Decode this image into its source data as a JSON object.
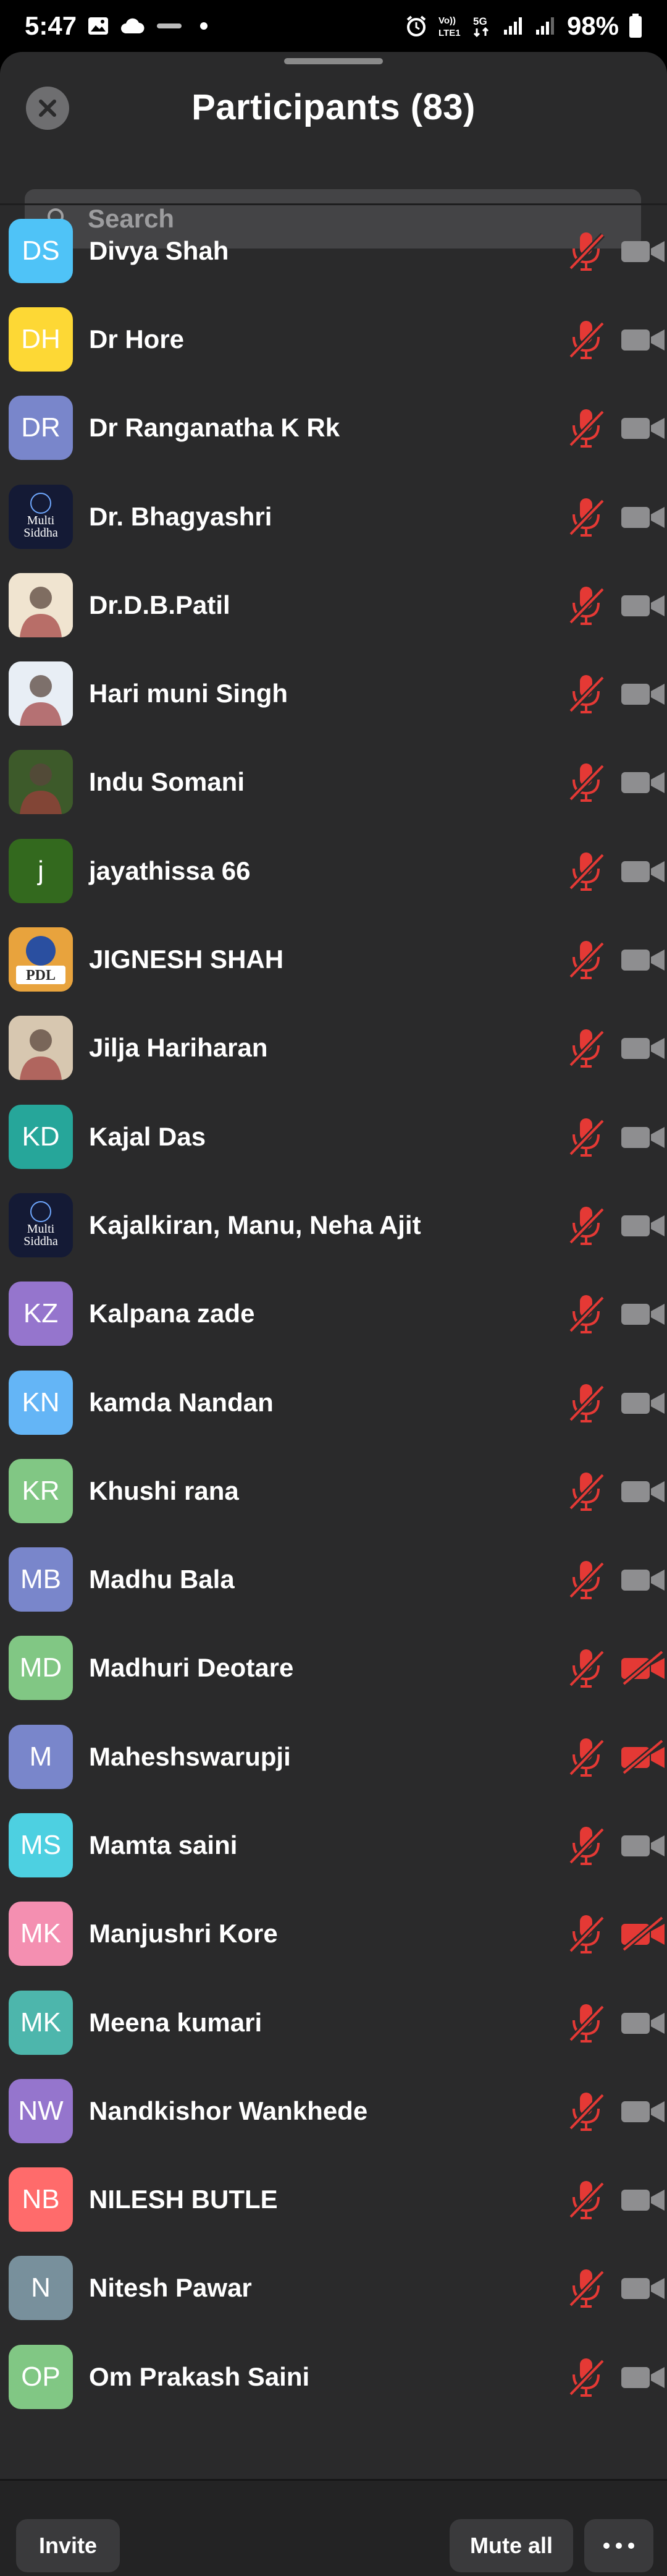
{
  "status_bar": {
    "time": "5:47",
    "battery": "98%",
    "icons": [
      "gallery-icon",
      "cloud-icon",
      "notification-icon",
      "alarm-icon",
      "volte-icon",
      "5g-icon",
      "signal-icon",
      "battery-icon"
    ]
  },
  "header": {
    "title": "Participants (83)",
    "close_icon": "close-icon"
  },
  "search": {
    "placeholder": "Search",
    "icon": "search-icon"
  },
  "colors": {
    "sheet_bg": "#2a2a2b",
    "muted_red": "#e53935",
    "cam_gray": "#8e8e90"
  },
  "participants": [
    {
      "name": "Divya Shah",
      "initials": "DS",
      "color": "#4fc3f7",
      "mic": "muted",
      "camera": "off-gray"
    },
    {
      "name": "Dr Hore",
      "initials": "DH",
      "color": "#fdd835",
      "mic": "muted",
      "camera": "off-gray"
    },
    {
      "name": "Dr Ranganatha K Rk",
      "initials": "DR",
      "color": "#7986cb",
      "mic": "muted",
      "camera": "off-gray"
    },
    {
      "name": "Dr. Bhagyashri",
      "initials": "",
      "color": "#1a2240",
      "avatar_image": "multi-siddha-logo",
      "mic": "muted",
      "camera": "off-gray"
    },
    {
      "name": "Dr.D.B.Patil",
      "initials": "",
      "color": "#f0e4d0",
      "avatar_image": "profile-photo",
      "mic": "muted",
      "camera": "off-gray"
    },
    {
      "name": "Hari muni Singh",
      "initials": "",
      "color": "#e8eef5",
      "avatar_image": "profile-photo",
      "mic": "muted",
      "camera": "off-gray"
    },
    {
      "name": "Indu Somani",
      "initials": "",
      "color": "#3d5a2a",
      "avatar_image": "profile-photo",
      "mic": "muted",
      "camera": "off-gray"
    },
    {
      "name": "jayathissa 66",
      "initials": "j",
      "color": "#33691e",
      "mic": "muted",
      "camera": "off-gray"
    },
    {
      "name": "JIGNESH SHAH",
      "initials": "",
      "color": "#e8a33d",
      "avatar_image": "pdl-logo",
      "mic": "muted",
      "camera": "off-gray"
    },
    {
      "name": "Jilja Hariharan",
      "initials": "",
      "color": "#d7c7b0",
      "avatar_image": "profile-photo",
      "mic": "muted",
      "camera": "off-gray"
    },
    {
      "name": "Kajal Das",
      "initials": "KD",
      "color": "#26a69a",
      "mic": "muted",
      "camera": "off-gray"
    },
    {
      "name": "Kajalkiran, Manu, Neha Ajit",
      "initials": "",
      "color": "#1a2240",
      "avatar_image": "multi-siddha-logo",
      "mic": "muted",
      "camera": "off-gray"
    },
    {
      "name": "Kalpana zade",
      "initials": "KZ",
      "color": "#9575cd",
      "mic": "muted",
      "camera": "off-gray"
    },
    {
      "name": "kamda Nandan",
      "initials": "KN",
      "color": "#64b5f6",
      "mic": "muted",
      "camera": "off-gray"
    },
    {
      "name": "Khushi rana",
      "initials": "KR",
      "color": "#81c784",
      "mic": "muted",
      "camera": "off-gray"
    },
    {
      "name": "Madhu Bala",
      "initials": "MB",
      "color": "#7986cb",
      "mic": "muted",
      "camera": "off-gray"
    },
    {
      "name": "Madhuri Deotare",
      "initials": "MD",
      "color": "#81c784",
      "mic": "muted",
      "camera": "off-red"
    },
    {
      "name": "Maheshswarupji",
      "initials": "M",
      "color": "#7986cb",
      "mic": "muted",
      "camera": "off-red"
    },
    {
      "name": "Mamta saini",
      "initials": "MS",
      "color": "#4dd0e1",
      "mic": "muted",
      "camera": "off-gray"
    },
    {
      "name": "Manjushri Kore",
      "initials": "MK",
      "color": "#f48fb1",
      "mic": "muted",
      "camera": "off-red"
    },
    {
      "name": "Meena kumari",
      "initials": "MK",
      "color": "#4db6ac",
      "mic": "muted",
      "camera": "off-gray"
    },
    {
      "name": "Nandkishor Wankhede",
      "initials": "NW",
      "color": "#9575cd",
      "mic": "muted",
      "camera": "off-gray"
    },
    {
      "name": "NILESH BUTLE",
      "initials": "NB",
      "color": "#ff6b6b",
      "mic": "muted",
      "camera": "off-gray"
    },
    {
      "name": "Nitesh Pawar",
      "initials": "N",
      "color": "#78909c",
      "mic": "muted",
      "camera": "off-gray"
    },
    {
      "name": "Om Prakash Saini",
      "initials": "OP",
      "color": "#81c784",
      "mic": "muted",
      "camera": "off-gray"
    }
  ],
  "footer": {
    "invite_label": "Invite",
    "mute_all_label": "Mute all",
    "more_icon": "more-icon"
  }
}
